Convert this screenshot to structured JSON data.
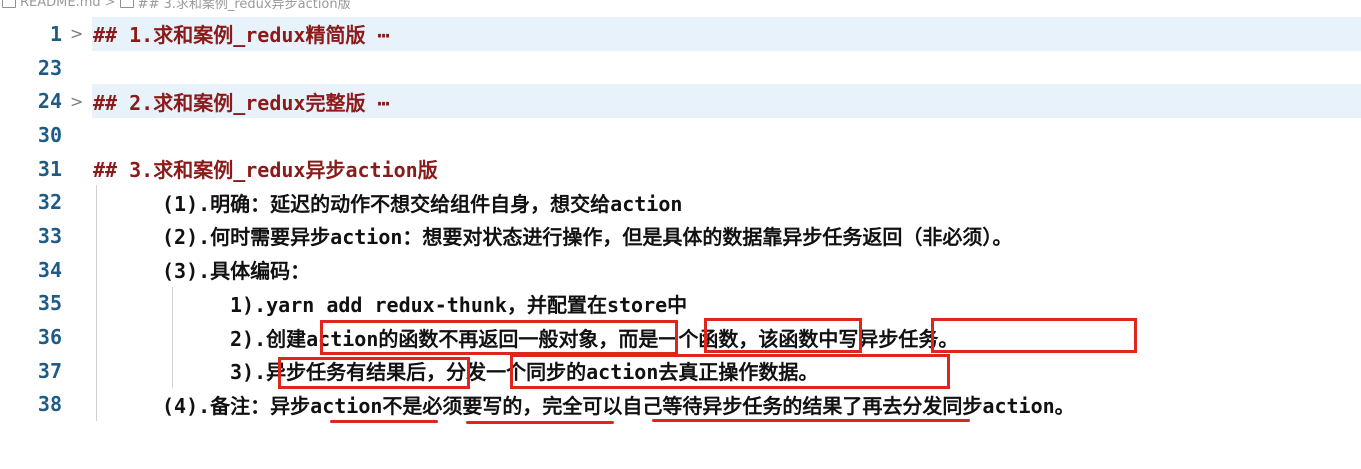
{
  "breadcrumb": {
    "file": "README.md",
    "separator": ">",
    "section": "## 3.求和案例_redux异步action版"
  },
  "lines": [
    {
      "num": "1",
      "text": "## 1.求和案例_redux精简版",
      "suffix": "⋯",
      "folded": true
    },
    {
      "num": "23",
      "text": ""
    },
    {
      "num": "24",
      "text": "## 2.求和案例_redux完整版",
      "suffix": "⋯",
      "folded": true
    },
    {
      "num": "30",
      "text": ""
    },
    {
      "num": "31",
      "text": "## 3.求和案例_redux异步action版"
    },
    {
      "num": "32",
      "text": "(1).明确：延迟的动作不想交给组件自身，想交给action"
    },
    {
      "num": "33",
      "text": "(2).何时需要异步action：想要对状态进行操作，但是具体的数据靠异步任务返回（非必须）。"
    },
    {
      "num": "34",
      "text": "(3).具体编码："
    },
    {
      "num": "35",
      "text": "1).yarn add redux-thunk，并配置在store中"
    },
    {
      "num": "36",
      "text": "2).创建action的函数不再返回一般对象，而是一个函数，该函数中写异步任务。"
    },
    {
      "num": "37",
      "text": "3).异步任务有结果后，分发一个同步的action去真正操作数据。"
    },
    {
      "num": "38",
      "text": "(4).备注：异步action不是必须要写的，完全可以自己等待异步任务的结果了再去分发同步action。"
    }
  ],
  "fold_marker": ">",
  "colors": {
    "heading": "#8b1a1a",
    "line_number": "#1e5c86",
    "folded_bg": "#e8f2fb",
    "annotation": "#e0261c"
  }
}
